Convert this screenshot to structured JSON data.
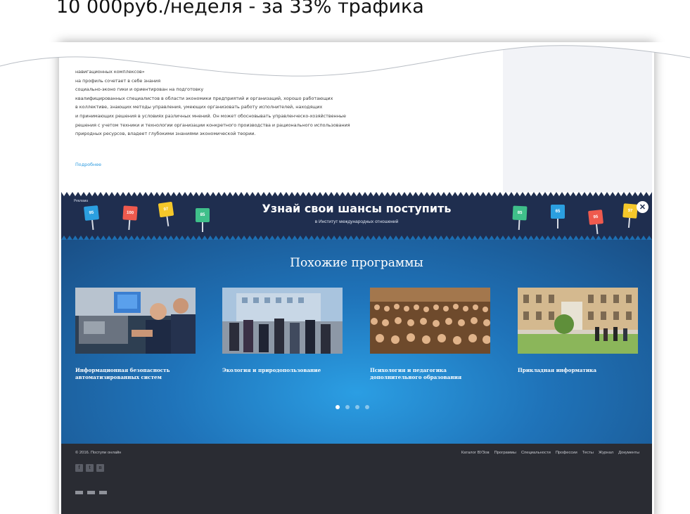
{
  "caption": "10 000руб./неделя - за 33% трафика",
  "article": {
    "lines": [
      "                                                                                     навигационных комплексов»",
      "на                                                                              профиль сочетает в себе знания",
      "социально-эконо                                               гики и  ориентирован на подготовку",
      "квалифицированных специалистов в области экономики предприятий и организаций,  хорошо работающих",
      "в коллективе, знающих методы управления, умеющих организовать работу исполнителей, находящих",
      "и принимающих решения в условиях различных мнений. Он может обосновывать управленческо-хозяйственные",
      "решения с учетом техники и технологии организации конкретного производства и рационального использования",
      "природных ресурсов, владеет глубокими знаниями экономической теории."
    ],
    "more_link": "Подробнее"
  },
  "promo": {
    "ad_label": "Реклама",
    "title": "Узнай свои шансы поступить",
    "subtitle": "в Институт международных отношений",
    "close_label": "✕",
    "flags_left": [
      {
        "value": "95",
        "color": "#2b9fe0"
      },
      {
        "value": "100",
        "color": "#ef5a4e"
      },
      {
        "value": "97",
        "color": "#f5c82a"
      },
      {
        "value": "85",
        "color": "#3fbf8a"
      }
    ],
    "flags_right": [
      {
        "value": "85",
        "color": "#3fbf8a"
      },
      {
        "value": "65",
        "color": "#2b9fe0"
      },
      {
        "value": "95",
        "color": "#ef5a4e"
      },
      {
        "value": "97",
        "color": "#f5c82a"
      }
    ]
  },
  "similar": {
    "title": "Похожие программы",
    "cards": [
      {
        "title": "Информационная безопасность автоматизированных систем"
      },
      {
        "title": "Экология и природопользование"
      },
      {
        "title": "Психология и педагогика дополнительного образования"
      },
      {
        "title": "Прикладная информатика"
      }
    ],
    "pager": {
      "count": 4,
      "active": 0
    }
  },
  "footer": {
    "copyright": "© 2016. Поступи онлайн",
    "nav": [
      "Каталог ВУЗов",
      "Программы",
      "Специальности",
      "Профессии",
      "Тесты",
      "Журнал",
      "Документы"
    ],
    "social": [
      {
        "icon": "facebook-icon",
        "glyph": "f"
      },
      {
        "icon": "twitter-icon",
        "glyph": "t"
      },
      {
        "icon": "vk-icon",
        "glyph": "в"
      }
    ]
  }
}
